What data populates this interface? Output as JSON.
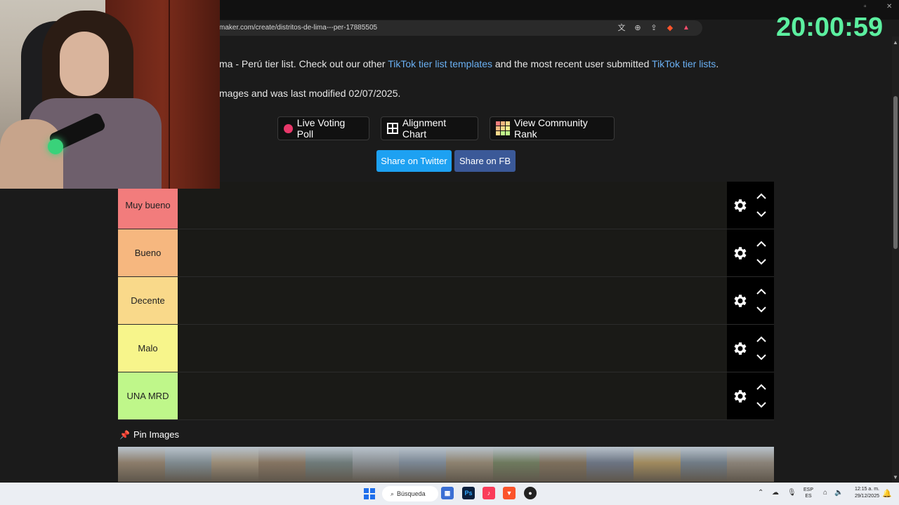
{
  "browser": {
    "url": "maker.com/create/distritos-de-lima---per-17885505"
  },
  "description": {
    "line1_prefix": "ma - Perú tier list. Check out our other ",
    "line1_link1": "TikTok tier list templates",
    "line1_middle": " and the most recent user submitted ",
    "line1_link2": "TikTok tier lists",
    "line1_suffix": ".",
    "line2": "mages and was last modified 02/07/2025."
  },
  "buttons": {
    "live_voting": "Live Voting Poll",
    "alignment_chart": "Alignment Chart",
    "community_rank": "View Community Rank",
    "share_twitter": "Share on Twitter",
    "share_fb": "Share on FB"
  },
  "tiers": [
    {
      "label": "Muy bueno",
      "color": "#f27c7c"
    },
    {
      "label": "Bueno",
      "color": "#f6b77f"
    },
    {
      "label": "Decente",
      "color": "#f9d98a"
    },
    {
      "label": "Malo",
      "color": "#f7f58b"
    },
    {
      "label": "UNA MRD",
      "color": "#bff78a"
    }
  ],
  "pin_images": {
    "label": "Pin Images",
    "thumbnail_count": 14
  },
  "overlay": {
    "clock": "20:00:59"
  },
  "taskbar": {
    "search_label": "Búsqueda",
    "lang_line1": "ESP",
    "lang_line2": "ES",
    "time": "12:15 a. m.",
    "date": "29/12/2025"
  },
  "colors": {
    "link": "#6ab0f3",
    "twitter": "#1da1f2",
    "facebook": "#3b5998",
    "clock": "#5cf0a0",
    "background": "#1b1b1b"
  }
}
